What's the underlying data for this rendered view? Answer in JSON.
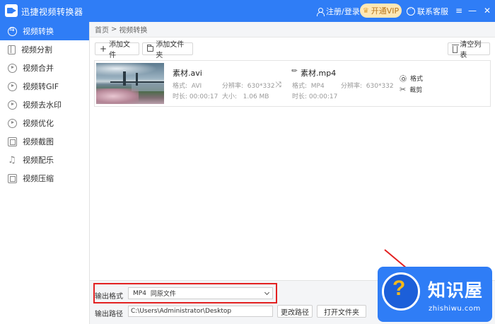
{
  "app": {
    "title": "迅捷视频转换器",
    "login_label": "注册/登录",
    "vip_label": "开通VIP",
    "service_label": "联系客服"
  },
  "sidebar": {
    "items": [
      {
        "label": "视频转换",
        "icon": "convert-icon",
        "active": true
      },
      {
        "label": "视频分割",
        "icon": "split-icon"
      },
      {
        "label": "视频合并",
        "icon": "merge-icon"
      },
      {
        "label": "视频转GIF",
        "icon": "gif-icon"
      },
      {
        "label": "视频去水印",
        "icon": "watermark-remove-icon"
      },
      {
        "label": "视频优化",
        "icon": "optimize-icon"
      },
      {
        "label": "视频截图",
        "icon": "screenshot-icon"
      },
      {
        "label": "视频配乐",
        "icon": "music-icon"
      },
      {
        "label": "视频压缩",
        "icon": "compress-icon"
      }
    ]
  },
  "breadcrumb": {
    "home": "首页",
    "separator": ">",
    "current": "视频转换"
  },
  "toolbar": {
    "add_file": "添加文件",
    "add_folder": "添加文件夹",
    "clear_list": "清空列表"
  },
  "file": {
    "source": {
      "name": "素材.avi",
      "format_label": "格式:",
      "format": "AVI",
      "resolution_label": "分辨率:",
      "resolution": "630*332",
      "duration_label": "时长:",
      "duration": "00:00:17",
      "size_label": "大小:",
      "size": "1.06 MB"
    },
    "output": {
      "name": "素材.mp4",
      "format_label": "格式:",
      "format": "MP4",
      "resolution_label": "分辨率:",
      "resolution": "630*332",
      "duration_label": "时长:",
      "duration": "00:00:17"
    },
    "actions": {
      "format": "格式",
      "cut": "裁剪"
    }
  },
  "bottom": {
    "output_format_label": "输出格式",
    "output_format_value": "MP4",
    "output_format_quality": "同原文件",
    "output_path_label": "输出路径",
    "output_path": "C:\\Users\\Administrator\\Desktop",
    "change_path": "更改路径",
    "open_folder": "打开文件夹"
  },
  "watermark": {
    "text": "知识屋",
    "url": "zhishiwu.com"
  },
  "colors": {
    "accent": "#2f7df6",
    "highlight": "#e32121",
    "vip": "#ffe8b6"
  }
}
